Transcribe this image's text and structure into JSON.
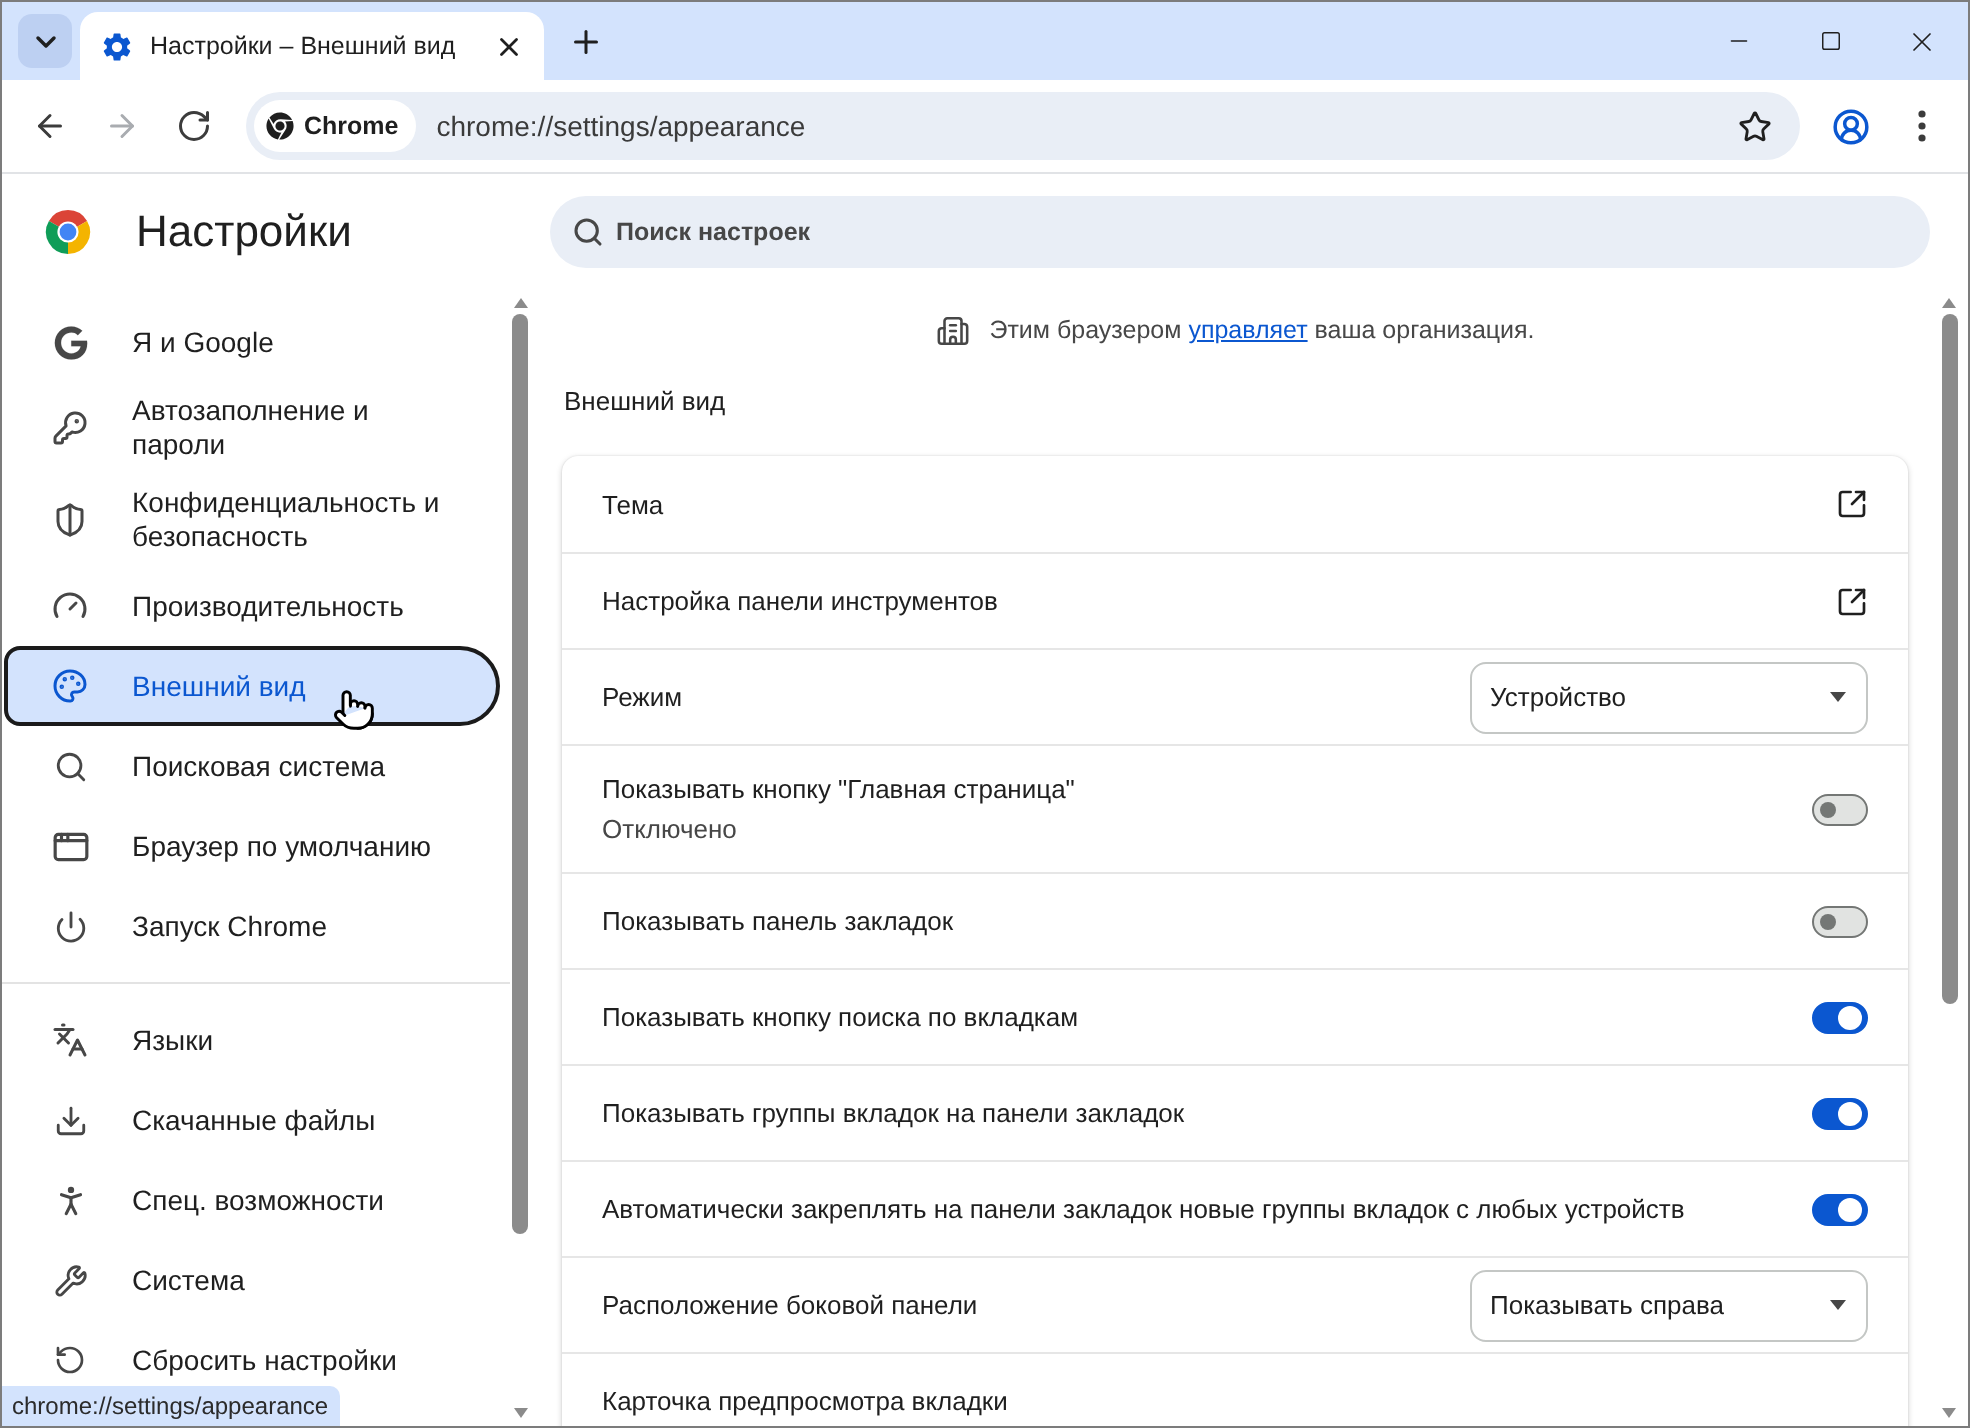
{
  "window": {
    "tabs": [
      {
        "title": "Настройки – Внешний вид",
        "selected": true
      }
    ]
  },
  "toolbar": {
    "nav_buttons": [
      {
        "kind": "back",
        "disabled": false
      },
      {
        "kind": "forward",
        "disabled": true
      },
      {
        "kind": "reload",
        "disabled": false
      }
    ],
    "omnibox": {
      "chip": "Chrome",
      "url": "chrome://settings/appearance"
    }
  },
  "header": {
    "title": "Настройки",
    "search": {
      "placeholder": "Поиск настроек"
    }
  },
  "sidebar": {
    "groups": [
      {
        "items": [
          {
            "label": "Я и Google",
            "selected": false
          },
          {
            "label": "Автозаполнение и пароли",
            "selected": false
          },
          {
            "label": "Конфиденциальность и безопасность",
            "selected": false
          },
          {
            "label": "Производительность",
            "selected": false
          },
          {
            "label": "Внешний вид",
            "selected": true
          },
          {
            "label": "Поисковая система",
            "selected": false
          },
          {
            "label": "Браузер по умолчанию",
            "selected": false
          },
          {
            "label": "Запуск Chrome",
            "selected": false
          }
        ]
      },
      {
        "items": [
          {
            "label": "Языки",
            "selected": false
          },
          {
            "label": "Скачанные файлы",
            "selected": false
          },
          {
            "label": "Спец. возможности",
            "selected": false
          },
          {
            "label": "Система",
            "selected": false
          },
          {
            "label": "Сбросить настройки",
            "selected": false
          }
        ]
      }
    ]
  },
  "main": {
    "notice": {
      "before": "Этим браузером",
      "link": "управляет",
      "after": "ваша организация."
    },
    "section_title": "Внешний вид",
    "rows": [
      {
        "kind": "link",
        "label": "Тема"
      },
      {
        "kind": "link",
        "label": "Настройка панели инструментов"
      },
      {
        "kind": "select",
        "label": "Режим",
        "value": "Устройство"
      },
      {
        "kind": "toggle",
        "label": "Показывать кнопку \"Главная страница\"",
        "sublabel": "Отключено",
        "on": false
      },
      {
        "kind": "toggle",
        "label": "Показывать панель закладок",
        "on": false
      },
      {
        "kind": "toggle",
        "label": "Показывать кнопку поиска по вкладкам",
        "on": true
      },
      {
        "kind": "toggle",
        "label": "Показывать группы вкладок на панели закладок",
        "on": true
      },
      {
        "kind": "toggle",
        "label": "Автоматически закреплять на панели закладок новые группы вкладок с любых устройств",
        "on": true
      },
      {
        "kind": "select",
        "label": "Расположение боковой панели",
        "value": "Показывать справа"
      },
      {
        "kind": "plain",
        "label": "Карточка предпросмотра вкладки"
      }
    ]
  },
  "status_bubble": "chrome://settings/appearance"
}
